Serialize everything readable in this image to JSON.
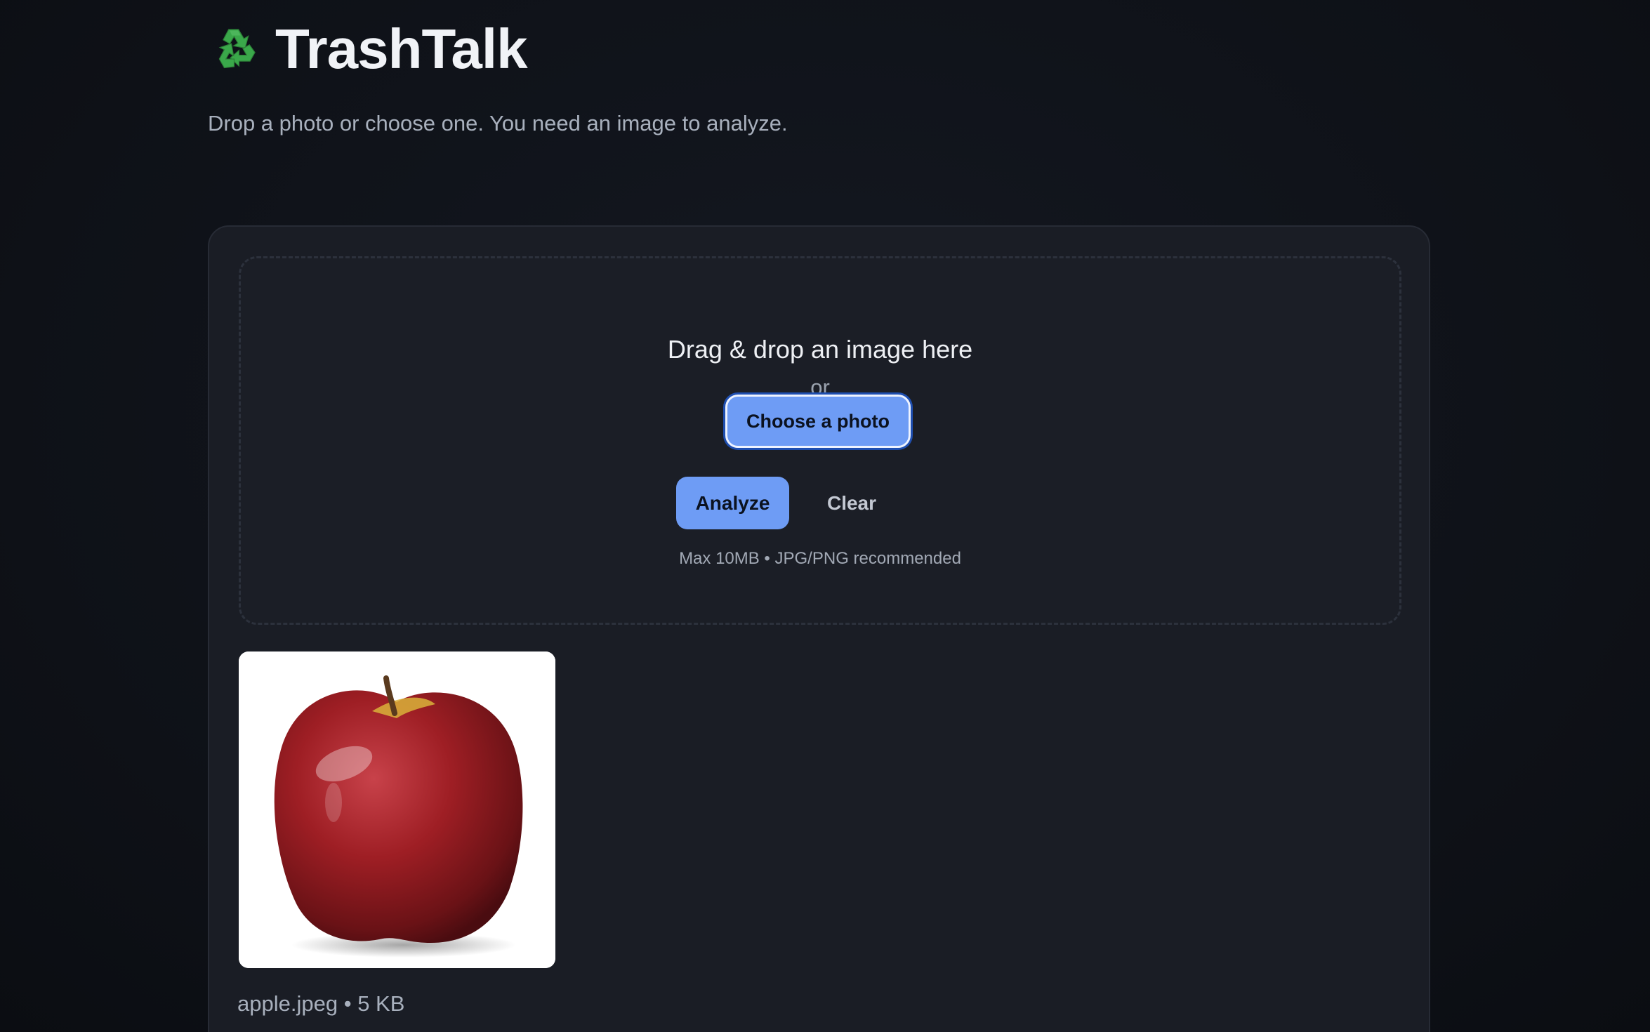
{
  "header": {
    "logo_icon": "recycle-icon",
    "title": "TrashTalk",
    "subtitle": "Drop a photo or choose one. You need an image to analyze."
  },
  "dropzone": {
    "title": "Drag & drop an image here",
    "or_text": "or",
    "choose_label": "Choose a photo",
    "analyze_label": "Analyze",
    "clear_label": "Clear",
    "hint": "Max 10MB • JPG/PNG recommended"
  },
  "preview": {
    "image_subject": "red apple",
    "file_name": "apple.jpeg",
    "separator": "•",
    "file_size": "5 KB"
  },
  "colors": {
    "accent": "#6e9cf5",
    "background": "#0f1218",
    "card": "#1a1d25",
    "recycle_green": "#3aa84a"
  }
}
